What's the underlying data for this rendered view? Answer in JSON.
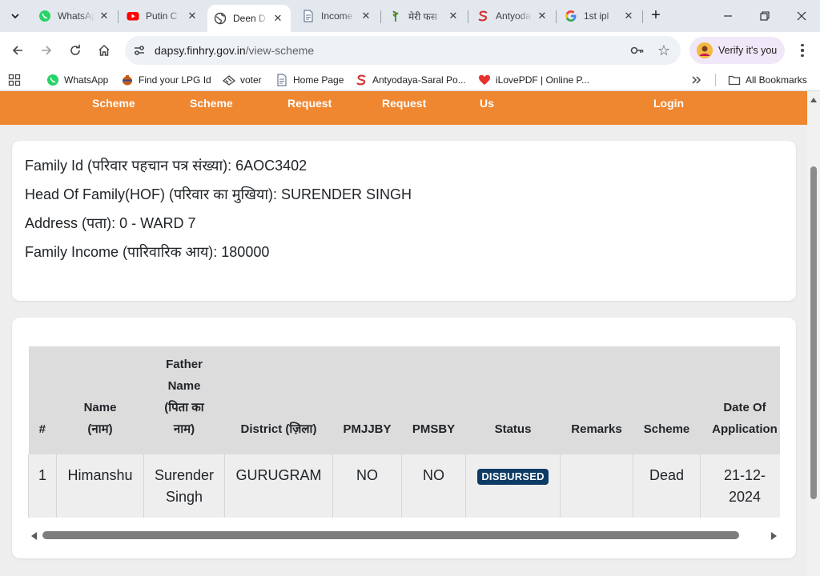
{
  "browser": {
    "tabs": [
      {
        "title": "WhatsApp",
        "icon": "whatsapp-icon",
        "active": false
      },
      {
        "title": "Putin C",
        "icon": "youtube-icon",
        "active": false
      },
      {
        "title": "Deen D",
        "icon": "globe-icon",
        "active": true
      },
      {
        "title": "Income",
        "icon": "document-icon",
        "active": false
      },
      {
        "title": "मेरी फस",
        "icon": "crop-icon",
        "active": false
      },
      {
        "title": "Antyoda",
        "icon": "saral-icon",
        "active": false
      },
      {
        "title": "1st ipl",
        "icon": "google-icon",
        "active": false
      }
    ],
    "url_host": "dapsy.finhry.gov.in",
    "url_path": "/view-scheme",
    "verify_label": "Verify it's you",
    "bookmarks": [
      {
        "label": "WhatsApp",
        "icon": "whatsapp-icon"
      },
      {
        "label": "Find your LPG Id",
        "icon": "lpg-icon"
      },
      {
        "label": "voter",
        "icon": "voter-icon"
      },
      {
        "label": "Home Page",
        "icon": "page-icon"
      },
      {
        "label": "Antyodaya-Saral Po...",
        "icon": "saral-icon"
      },
      {
        "label": "iLovePDF | Online P...",
        "icon": "heart-icon"
      }
    ],
    "all_bookmarks_label": "All Bookmarks"
  },
  "site_nav": {
    "links": [
      "Scheme",
      "Scheme",
      "Request",
      "Request",
      "Us",
      "Login"
    ]
  },
  "family": {
    "id_line": "Family Id (परिवार पहचान पत्र संख्या): 6AOC3402",
    "hof_line": "Head Of Family(HOF) (परिवार का मुखिया): SURENDER SINGH",
    "address_line": "Address (पता): 0 - WARD 7",
    "income_line": "Family Income (पारिवारिक आय): 180000"
  },
  "table": {
    "headers": {
      "num": "#",
      "name_1": "Name",
      "name_2": "(नाम)",
      "father_1": "Father",
      "father_2": "Name",
      "father_3": "(पिता का",
      "father_4": "नाम)",
      "district": "District (ज़िला)",
      "pmjjby": "PMJJBY",
      "pmsby": "PMSBY",
      "status": "Status",
      "remarks": "Remarks",
      "scheme": "Scheme",
      "doa_1": "Date Of",
      "doa_2": "Application"
    },
    "rows": [
      {
        "num": "1",
        "name": "Himanshu",
        "father_1": "Surender",
        "father_2": "Singh",
        "district": "GURUGRAM",
        "pmjjby": "NO",
        "pmsby": "NO",
        "status": "DISBURSED",
        "remarks": "",
        "scheme": "Dead",
        "doa_1": "21-12-",
        "doa_2": "2024"
      }
    ]
  },
  "colors": {
    "nav_bar": "#ef8630",
    "status_badge": "#0d3b66"
  }
}
